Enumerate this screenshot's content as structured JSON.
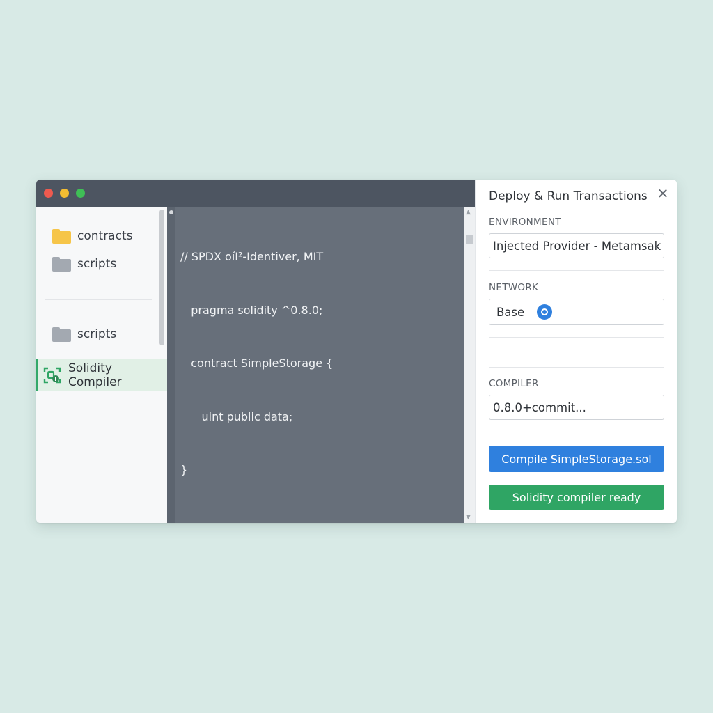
{
  "sidebar": {
    "items": [
      {
        "label": "contracts",
        "icon": "folder-icon",
        "color": "#f6c549"
      },
      {
        "label": "scripts",
        "icon": "folder-icon",
        "color": "#a3a9b1"
      },
      {
        "label": "scripts",
        "icon": "folder-icon",
        "color": "#a3a9b1"
      }
    ],
    "active_item": {
      "label": "Solidity Compiler",
      "icon": "solidity-compiler-icon"
    }
  },
  "editor": {
    "lines": [
      "// SPDX oíΙ²-Identiver, MIT",
      "   pragma solidity ^0.8.0;",
      "   contract SimpleStorage {",
      "      uint public data;",
      "}"
    ]
  },
  "panel": {
    "title": "Deploy & Run Transactions",
    "environment_label": "ENVIRONMENT",
    "environment_value": "Injected Provider - Metamsak",
    "network_label": "NETWORK",
    "network_value": "Base",
    "network_icon": "network-icon",
    "compiler_label": "COMPILER",
    "compiler_value": "0.8.0+commit...",
    "compile_button": "Compile SimpleStorage.sol",
    "status_button": "Solidity compiler ready"
  },
  "colors": {
    "accent_blue": "#2f80de",
    "accent_green": "#2fa564",
    "editor_bg": "#676f7a",
    "titlebar": "#4d5561"
  }
}
